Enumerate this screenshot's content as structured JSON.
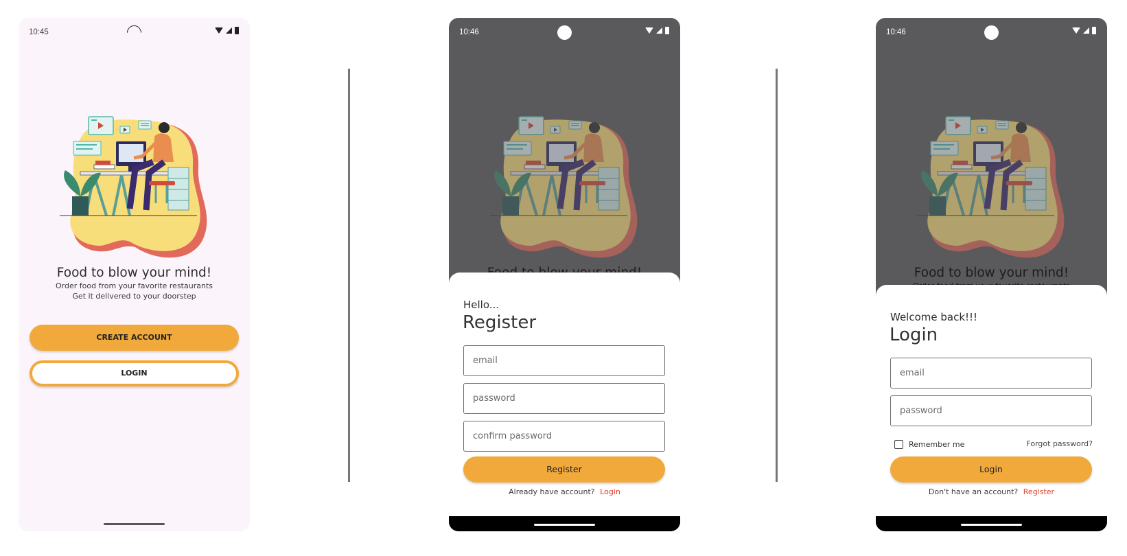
{
  "screen1": {
    "time": "10:45",
    "title": "Food to blow your mind!",
    "subtitle_line1": "Order food from your favorite restaurants",
    "subtitle_line2": "Get it delivered to your doorstep",
    "create_account_label": "CREATE ACCOUNT",
    "login_label": "LOGIN"
  },
  "screen2": {
    "time": "10:46",
    "background_title": "Food to blow your mind!",
    "greeting": "Hello...",
    "heading": "Register",
    "email_placeholder": "email",
    "password_placeholder": "password",
    "confirm_placeholder": "confirm password",
    "button_label": "Register",
    "switch_text": "Already have account?",
    "switch_link": "Login"
  },
  "screen3": {
    "time": "10:46",
    "background_title": "Food to blow your mind!",
    "background_subtitle": "Order food from your favorite restaurants",
    "greeting": "Welcome back!!!",
    "heading": "Login",
    "email_placeholder": "email",
    "password_placeholder": "password",
    "remember_label": "Remember me",
    "remember_checked": false,
    "forgot_label": "Forgot password?",
    "button_label": "Login",
    "switch_text": "Don't have an account?",
    "switch_link": "Register"
  },
  "colors": {
    "accent": "#f1a93b",
    "link": "#d8402c",
    "screen_bg": "#fcf4fb",
    "scrim": "#5a595c"
  },
  "icons": {
    "status": [
      "wifi-icon",
      "signal-icon",
      "battery-icon"
    ],
    "illustration": "person-at-desk-illustration"
  }
}
